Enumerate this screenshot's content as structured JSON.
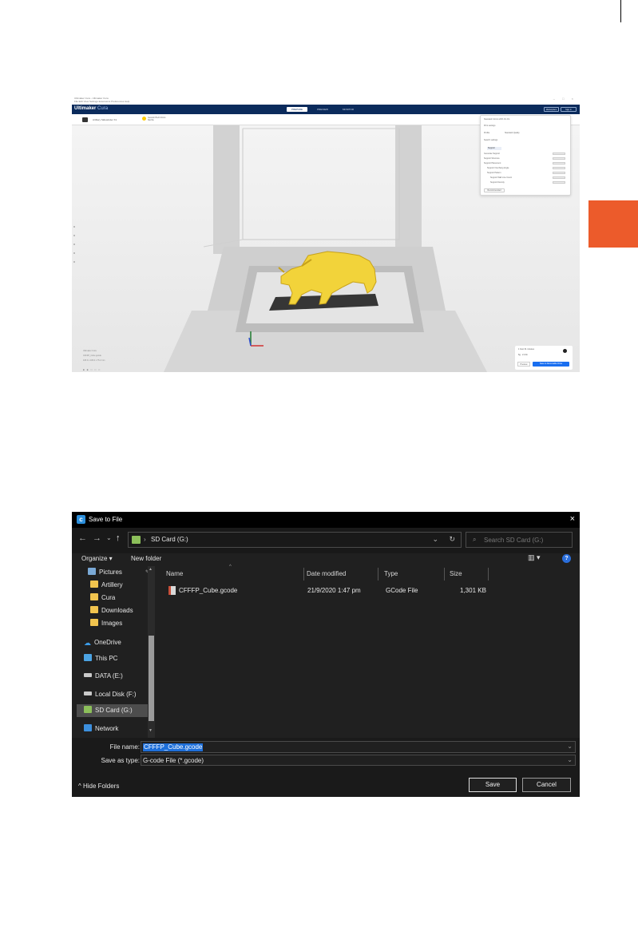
{
  "cura": {
    "title_line1": "Ultimaker Cura - Ultimaker Cura",
    "title_line2": "File  Edit  View  Settings  Extensions  Preferences  Help",
    "logo_main": "Ultimaker",
    "logo_sub": "Cura",
    "stages": [
      "PREPARE",
      "PREVIEW",
      "MONITOR"
    ],
    "header_buttons": [
      "Marketplace",
      "Sign in"
    ],
    "printer": "Artillery Sidewinder X1",
    "material": "Generic PLA 0.4mm Nozzle",
    "print_settings": {
      "summary": "Standard  0.2mm  20%  On  On",
      "title": "Print settings",
      "profile_label": "Profile",
      "profile_value": "Standard Quality",
      "search_placeholder": "Search settings",
      "category": "Support",
      "rows": [
        "Generate Support",
        "Support Structure",
        "Support Placement",
        "Support Overhang Angle",
        "Support Pattern",
        "Support Wall Line Count",
        "Support Density"
      ],
      "button": "Recommended"
    },
    "action_panel": {
      "time": "1 hour 31 minutes",
      "material": "6g · 2.13m",
      "preview": "Preview",
      "save": "Save to Removable Drive"
    },
    "object_info": [
      "Ultimaker Cura",
      "CFFFP_Cube.gcode",
      "105.0 x 105.0 x 75.2 mm"
    ],
    "colors": {
      "header": "#0b2b5c",
      "accent": "#196ef0",
      "model": "#f2d33a"
    }
  },
  "dialog": {
    "title": "Save to File",
    "nav": {
      "back": "←",
      "forward": "→",
      "recent": "⌄",
      "up": "↑"
    },
    "address": {
      "location": "SD Card (G:)",
      "separator": "›"
    },
    "search_placeholder": "Search SD Card (G:)",
    "commands": {
      "organize": "Organize ▾",
      "new_folder": "New folder",
      "help": "?"
    },
    "sidebar": [
      {
        "label": "Pictures",
        "icon": "pictures-icon"
      },
      {
        "label": "Artillery",
        "icon": "folder-icon"
      },
      {
        "label": "Cura",
        "icon": "folder-icon"
      },
      {
        "label": "Downloads",
        "icon": "folder-icon"
      },
      {
        "label": "Images",
        "icon": "folder-icon"
      },
      {
        "label": "OneDrive",
        "icon": "cloud-icon"
      },
      {
        "label": "This PC",
        "icon": "pc-icon"
      },
      {
        "label": "DATA (E:)",
        "icon": "drive-icon"
      },
      {
        "label": "Local Disk (F:)",
        "icon": "drive-icon"
      },
      {
        "label": "SD Card (G:)",
        "icon": "sd-card-icon",
        "selected": true
      },
      {
        "label": "Network",
        "icon": "network-icon"
      }
    ],
    "columns": [
      "Name",
      "Date modified",
      "Type",
      "Size"
    ],
    "files": [
      {
        "name": "CFFFP_Cube.gcode",
        "date": "21/9/2020 1:47 pm",
        "type": "GCode File",
        "size": "1,301 KB"
      }
    ],
    "file_name_label": "File name:",
    "file_name_value": "CFFFP_Cube.gcode",
    "save_type_label": "Save as type:",
    "save_type_value": "G-code File (*.gcode)",
    "hide_folders": "Hide Folders",
    "save_label": "Save",
    "cancel_label": "Cancel"
  }
}
